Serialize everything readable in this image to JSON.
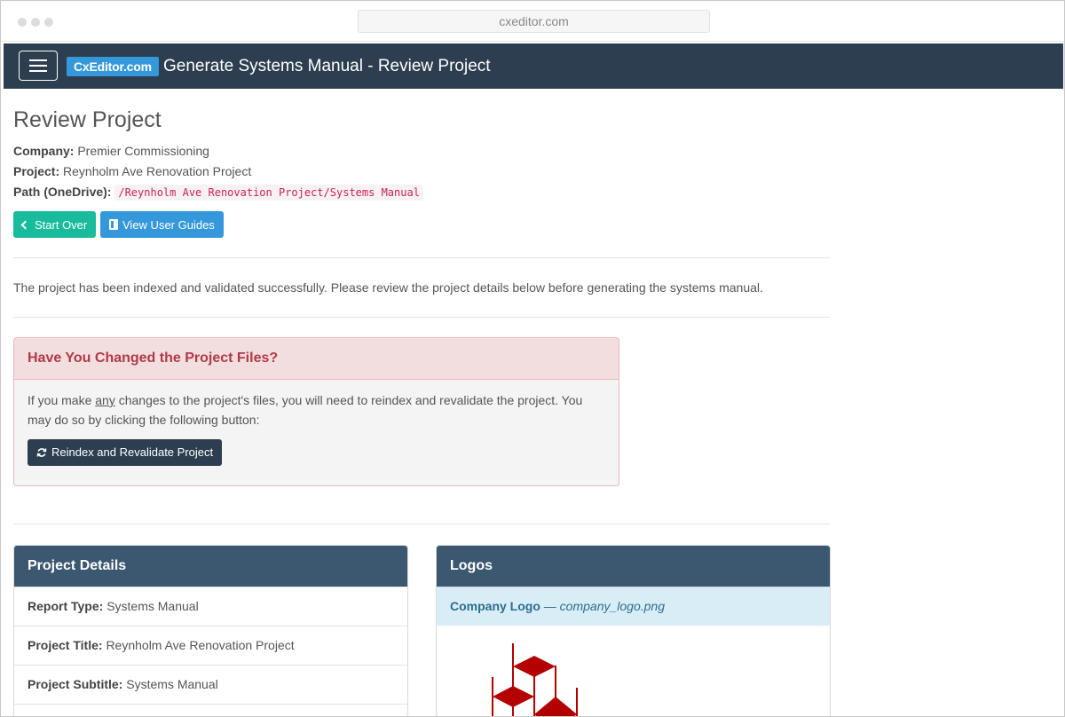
{
  "browser": {
    "url": "cxeditor.com"
  },
  "navbar": {
    "brand": "CxEditor.com",
    "title": "Generate Systems Manual - Review Project"
  },
  "page": {
    "title": "Review Project",
    "company_label": "Company:",
    "company_value": "Premier Commissioning",
    "project_label": "Project:",
    "project_value": "Reynholm Ave Renovation Project",
    "path_label": "Path (OneDrive):",
    "path_value": "/Reynholm Ave Renovation Project/Systems Manual",
    "start_over": "Start Over",
    "view_guides": "View User Guides",
    "lead": "The project has been indexed and validated successfully. Please review the project details below before generating the systems manual."
  },
  "alert": {
    "title": "Have You Changed the Project Files?",
    "text_before": "If you make ",
    "text_underlined": "any",
    "text_after": " changes to the project's files, you will need to reindex and revalidate the project. You may do so by clicking the following button:",
    "button": "Reindex and Revalidate Project"
  },
  "details": {
    "title": "Project Details",
    "rows": [
      {
        "label": "Report Type:",
        "value": "Systems Manual"
      },
      {
        "label": "Project Title:",
        "value": "Reynholm Ave Renovation Project"
      },
      {
        "label": "Project Subtitle:",
        "value": "Systems Manual"
      }
    ]
  },
  "logos": {
    "title": "Logos",
    "company_logo_label": "Company Logo",
    "separator": "—",
    "company_logo_file": "company_logo.png"
  },
  "colors": {
    "navbar": "#2d3e50",
    "brand": "#3498db",
    "success": "#18bc9c",
    "panel_head": "#3c5870",
    "logo_red": "#b30000"
  }
}
